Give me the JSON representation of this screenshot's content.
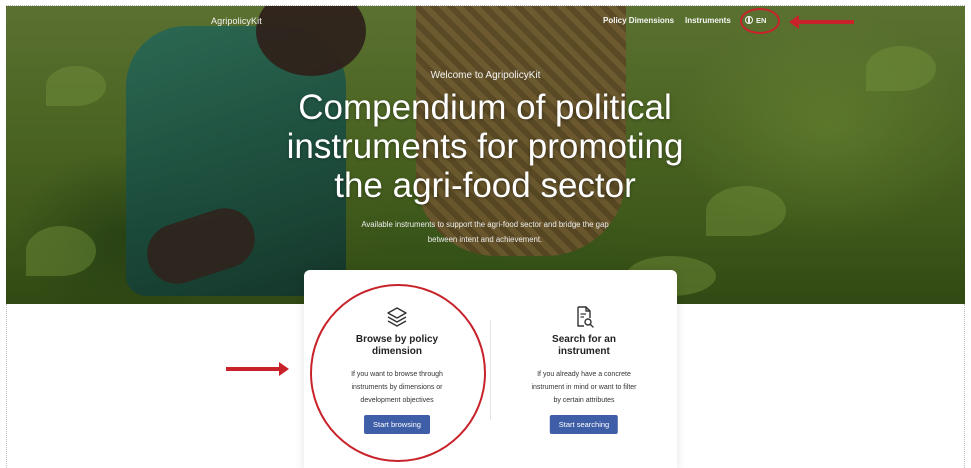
{
  "header": {
    "brand": "AgripolicyKit",
    "nav": {
      "dimensions": "Policy Dimensions",
      "instruments": "Instruments",
      "language": "EN"
    }
  },
  "hero": {
    "welcome": "Welcome to AgripolicyKit",
    "title_line1": "Compendium of political",
    "title_line2": "instruments for promoting",
    "title_line3": "the agri-food sector",
    "subtitle_line1": "Available instruments to support the agri-food sector and bridge the gap",
    "subtitle_line2": "between intent and achievement."
  },
  "options": [
    {
      "icon": "layers-icon",
      "title_line1": "Browse by policy",
      "title_line2": "dimension",
      "desc_line1": "If you want to browse through",
      "desc_line2": "instruments by dimensions or",
      "desc_line3": "development objectives",
      "button": "Start browsing"
    },
    {
      "icon": "document-search-icon",
      "title_line1": "Search for an",
      "title_line2": "instrument",
      "desc_line1": "If you already have a concrete",
      "desc_line2": "instrument in mind or want to filter",
      "desc_line3": "by certain attributes",
      "button": "Start searching"
    }
  ],
  "colors": {
    "accent_button": "#3f5ea8",
    "annotation_red": "#c8222a"
  }
}
